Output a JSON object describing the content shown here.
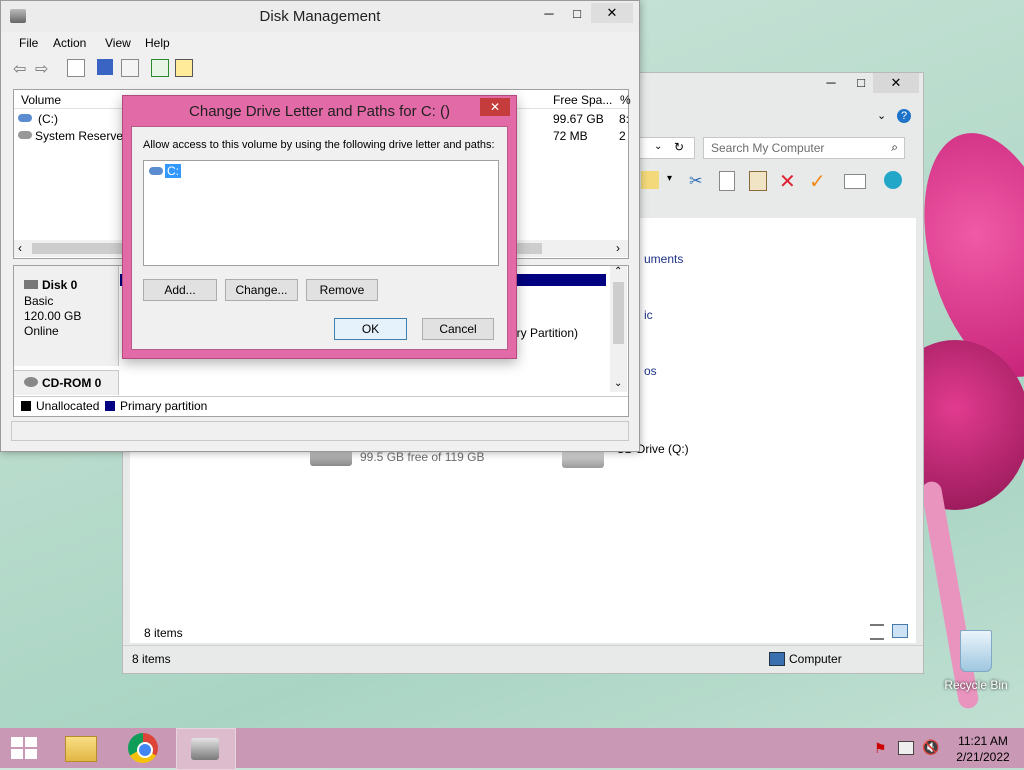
{
  "colors": {
    "accent": "#e26aa6",
    "taskbar": "#c998b4",
    "selection": "#3399ff",
    "primary_partition": "#000080"
  },
  "desktop": {
    "recycle_bin_label": "Recycle Bin"
  },
  "explorer": {
    "search_placeholder": "Search My Computer",
    "items_text_1": "8 items",
    "items_text_2": "8 items",
    "computer_label": "Computer",
    "fragments": [
      "uments",
      "ic",
      "os"
    ],
    "drive1_free": "99.5 GB free of 119 GB",
    "drive1_usage_fraction": 0.17,
    "cd_drive_label": "CD Drive (Q:)"
  },
  "disk_management": {
    "title": "Disk Management",
    "menu": [
      "File",
      "Action",
      "View",
      "Help"
    ],
    "columns": {
      "volume": "Volume",
      "free_space": "Free Spa...",
      "pct": "%"
    },
    "volumes": [
      {
        "name": "(C:)",
        "free": "99.67 GB",
        "pct": "8:"
      },
      {
        "name": "System Reserved",
        "free": "72 MB",
        "pct": "2"
      }
    ],
    "disk0": {
      "name": "Disk 0",
      "type": "Basic",
      "size": "120.00 GB",
      "status": "Online"
    },
    "partition_text": "ary Partition)",
    "cdrom": {
      "name": "CD-ROM 0"
    },
    "legend": {
      "unallocated": "Unallocated",
      "primary": "Primary partition"
    }
  },
  "dialog": {
    "title": "Change Drive Letter and Paths for C: ()",
    "description": "Allow access to this volume by using the following drive letter and paths:",
    "list_item": "C:",
    "add": "Add...",
    "change": "Change...",
    "remove": "Remove",
    "ok": "OK",
    "cancel": "Cancel"
  },
  "clock": {
    "time": "11:21 AM",
    "date": "2/21/2022"
  }
}
